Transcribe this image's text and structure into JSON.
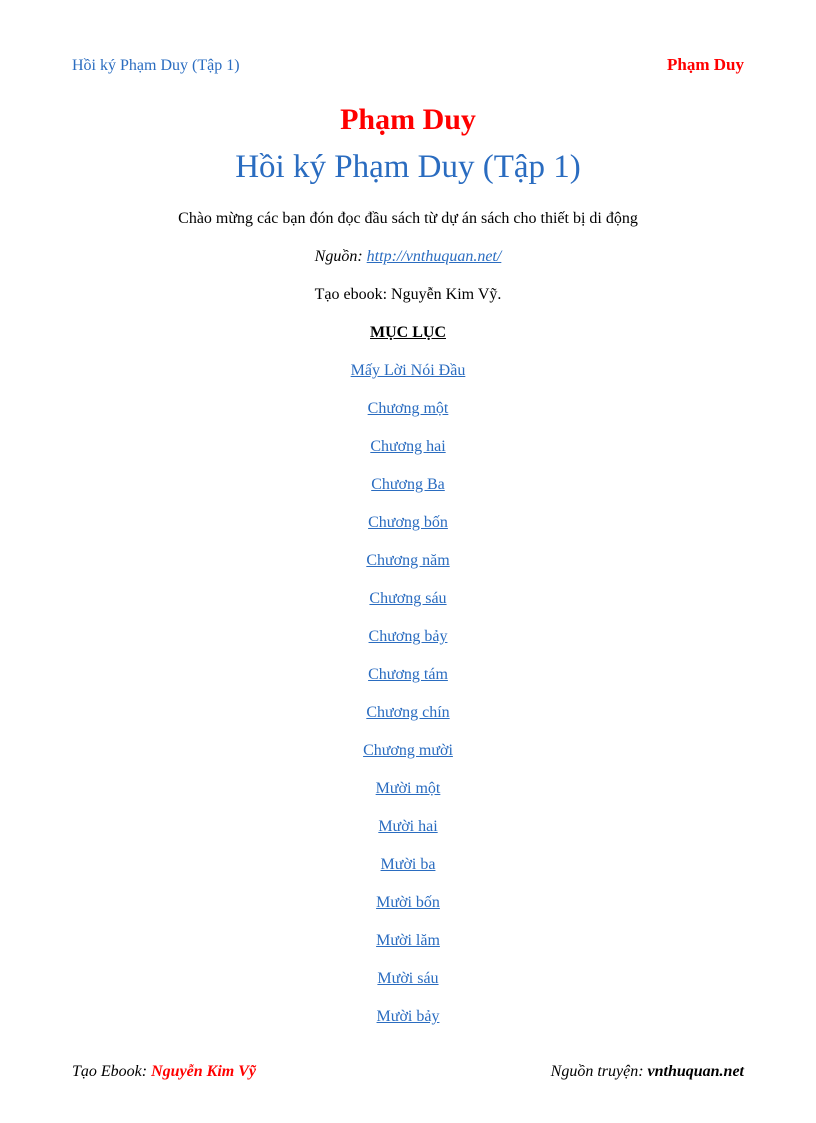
{
  "header": {
    "left": "Hồi ký Phạm Duy (Tập 1)",
    "right": "Phạm Duy"
  },
  "title": {
    "author": "Phạm Duy",
    "book": "Hồi ký Phạm Duy (Tập 1)"
  },
  "intro": {
    "welcome": "Chào mừng các bạn đón đọc đầu sách từ dự án sách cho thiết bị di động",
    "source_label": "Nguồn: ",
    "source_url": "http://vnthuquan.net/",
    "creator_line": "Tạo ebook: Nguyễn Kim Vỹ."
  },
  "toc": {
    "heading": "MỤC LỤC",
    "items": [
      "Mấy Lời Nói Đầu",
      "Chương một",
      "Chương hai",
      "Chương Ba",
      "Chương bốn",
      "Chương năm",
      "Chương sáu",
      "Chương bảy",
      "Chương tám",
      "Chương chín",
      "Chương mười",
      "Mười một",
      "Mười hai",
      "Mười ba",
      "Mười bốn",
      "Mười lăm",
      "Mười sáu",
      "Mười bảy"
    ]
  },
  "footer": {
    "left_label": "Tạo Ebook: ",
    "left_creator": "Nguyễn Kim Vỹ",
    "right_label": "Nguồn truyện: ",
    "right_site": "vnthuquan.net"
  }
}
